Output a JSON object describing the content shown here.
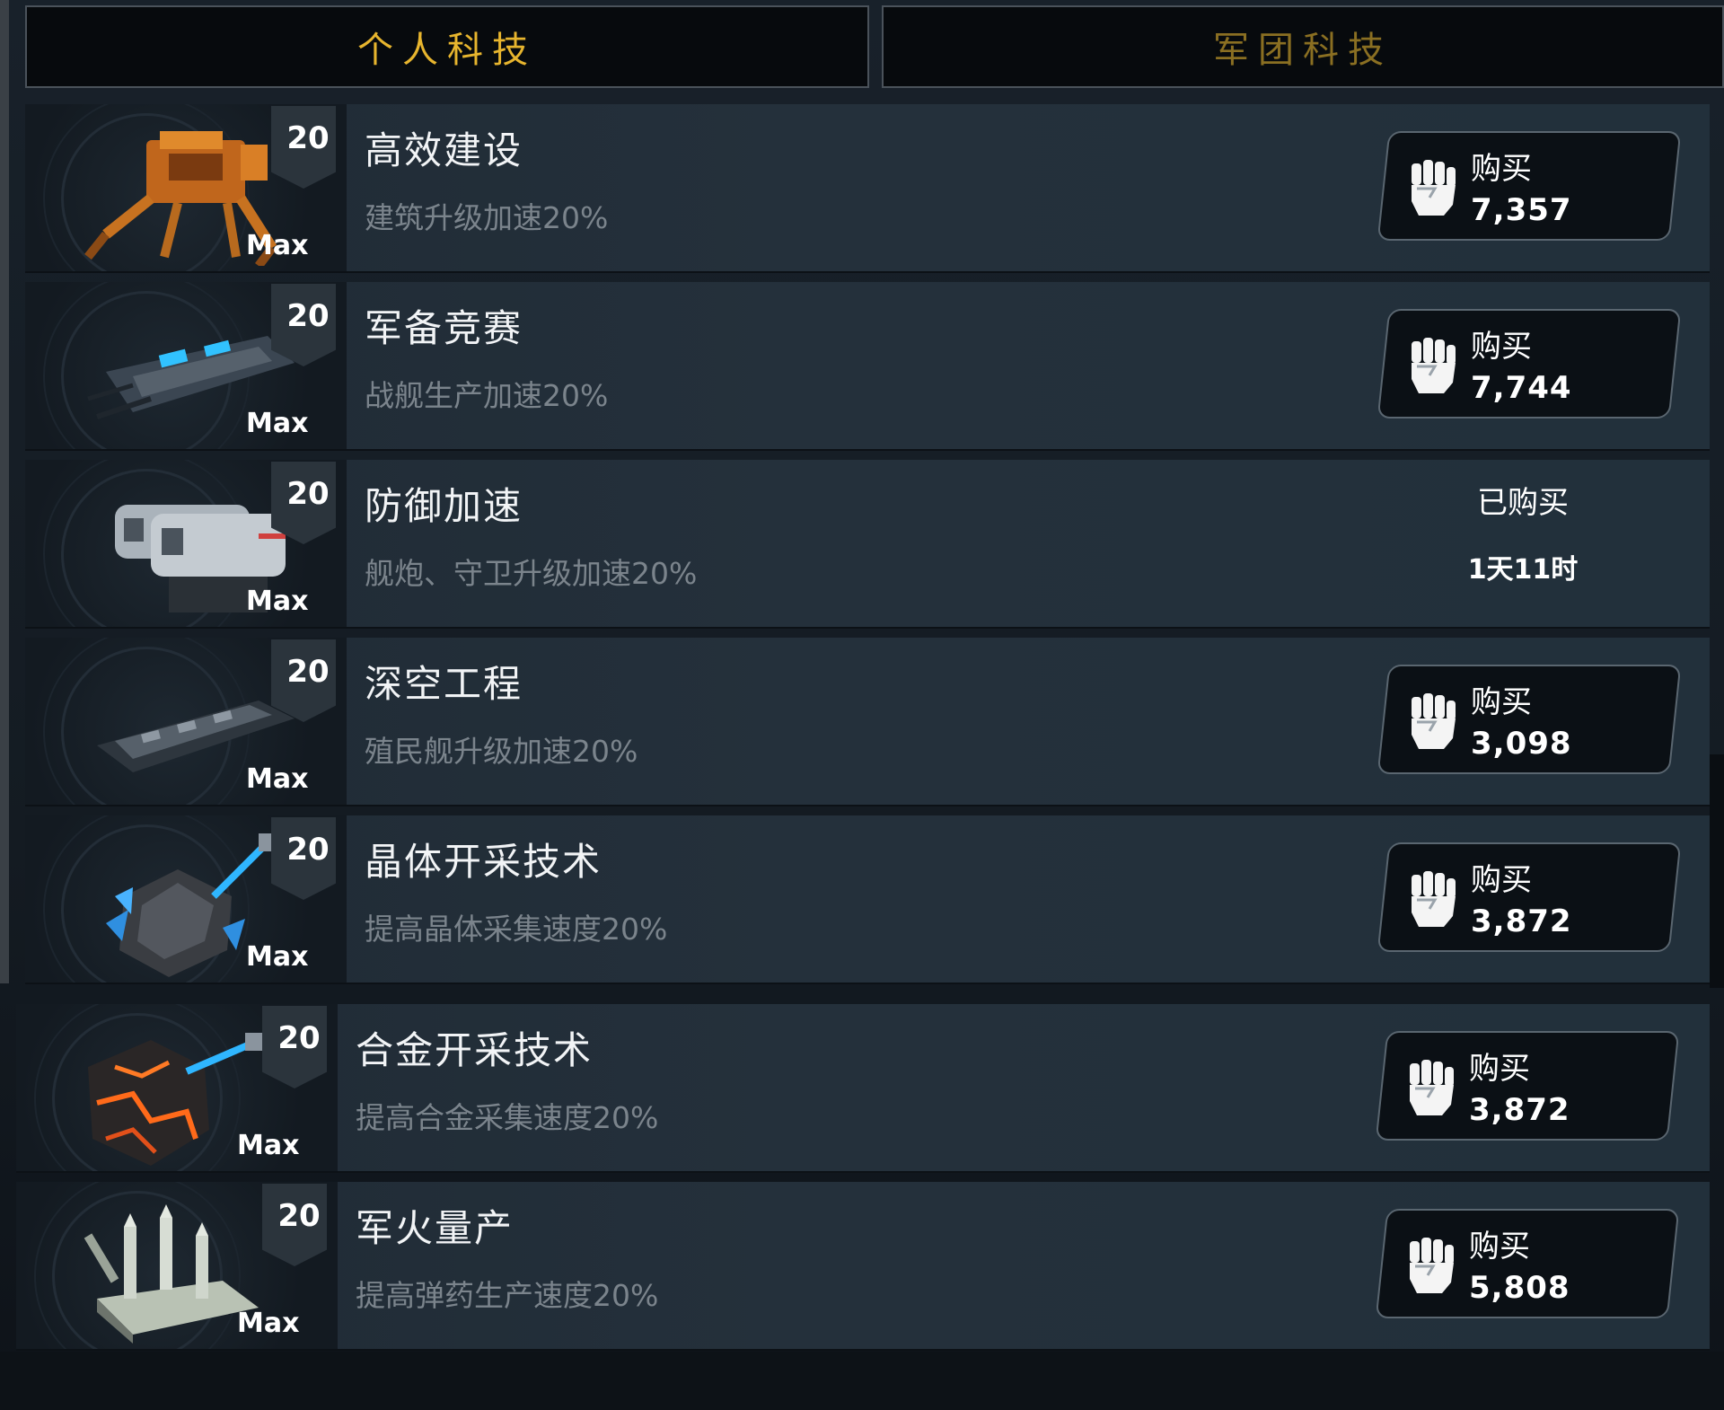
{
  "tabs": {
    "personal": "个人科技",
    "legion": "军团科技"
  },
  "colors": {
    "tab_active": "#e7b52e",
    "tab_inactive": "#8a6f22",
    "desc_text": "#7b848c"
  },
  "techs": [
    {
      "name": "高效建设",
      "desc": "建筑升级加速20%",
      "level": "20",
      "max": "Max",
      "status": "buy",
      "buy_label": "购买",
      "price": "7,357",
      "icon": "mech-walker-icon"
    },
    {
      "name": "军备竞赛",
      "desc": "战舰生产加速20%",
      "level": "20",
      "max": "Max",
      "status": "buy",
      "buy_label": "购买",
      "price": "7,744",
      "icon": "battleship-icon"
    },
    {
      "name": "防御加速",
      "desc": "舰炮、守卫升级加速20%",
      "level": "20",
      "max": "Max",
      "status": "owned",
      "owned_label": "已购买",
      "time_left": "1天11时",
      "icon": "turret-icon"
    },
    {
      "name": "深空工程",
      "desc": "殖民舰升级加速20%",
      "level": "20",
      "max": "Max",
      "status": "buy",
      "buy_label": "购买",
      "price": "3,098",
      "icon": "colony-ship-icon"
    },
    {
      "name": "晶体开采技术",
      "desc": "提高晶体采集速度20%",
      "level": "20",
      "max": "Max",
      "status": "buy",
      "buy_label": "购买",
      "price": "3,872",
      "icon": "crystal-asteroid-icon"
    },
    {
      "name": "合金开采技术",
      "desc": "提高合金采集速度20%",
      "level": "20",
      "max": "Max",
      "status": "buy",
      "buy_label": "购买",
      "price": "3,872",
      "icon": "alloy-asteroid-icon"
    },
    {
      "name": "军火量产",
      "desc": "提高弹药生产速度20%",
      "level": "20",
      "max": "Max",
      "status": "buy",
      "buy_label": "购买",
      "price": "5,808",
      "icon": "munitions-factory-icon"
    }
  ]
}
